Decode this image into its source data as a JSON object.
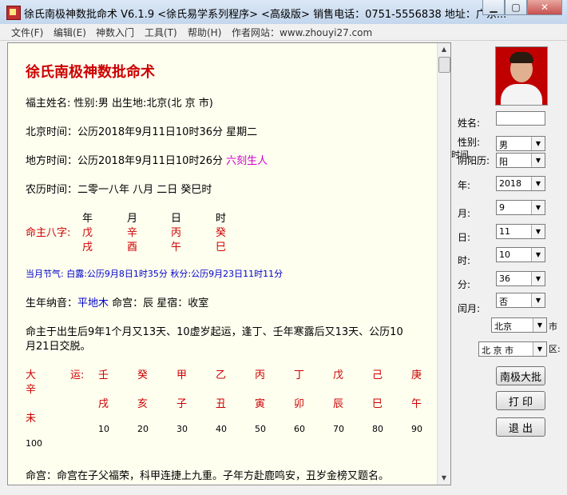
{
  "window": {
    "title": "徐氏南极神数批命术 V6.1.9 <徐氏易学系列程序> <高级版>  销售电话：0751-5556838   地址：广东...",
    "min_icon": "minimize-icon",
    "max_icon": "maximize-icon",
    "close_icon": "close-icon",
    "min_glyph": "▁",
    "max_glyph": "▢",
    "close_glyph": "✕"
  },
  "menu": [
    "文件(F)",
    "编辑(E)",
    "神数入门",
    "工具(T)",
    "帮助(H)",
    "作者网站：www.zhouyi27.com"
  ],
  "report": {
    "title": "徐氏南极神数批命术",
    "name_line": "福主姓名:   性别:男   出生地:北京(北 京 市)",
    "beijing_time": "北京时间：公历2018年9月11日10时36分  星期二",
    "local_time_prefix": "地方时间：公历2018年9月11日10时26分",
    "local_time_suffix": "六刻生人",
    "lunar": "农历时间：二零一八年  八月  二日  癸巳时",
    "bazi": {
      "label": "命主八字:",
      "headers": [
        "年",
        "月",
        "日",
        "时"
      ],
      "stems": [
        "戊",
        "辛",
        "丙",
        "癸"
      ],
      "branches": [
        "戌",
        "酉",
        "午",
        "巳"
      ]
    },
    "solar_term": "当月节气:   白露:公历9月8日1时35分  秋分:公历9月23日11时11分",
    "nayin_prefix": "生年纳音：",
    "nayin_value": "平地木",
    "nayin_suffix": "   命宫：辰   星宿：收室",
    "luck_start_1": "命主于出生后9年1个月又13天、10虚岁起运，逢丁、壬年寒露后又13天、公历10",
    "luck_start_2": "月21日交脱。",
    "dayun": {
      "label_1": "大",
      "label_2": "运:",
      "label_3": "辛",
      "label_4": "未",
      "stems": [
        "壬",
        "癸",
        "甲",
        "乙",
        "丙",
        "丁",
        "戊",
        "己",
        "庚"
      ],
      "branches": [
        "戌",
        "亥",
        "子",
        "丑",
        "寅",
        "卯",
        "辰",
        "巳",
        "午"
      ],
      "ages": [
        "10",
        "20",
        "30",
        "40",
        "50",
        "60",
        "70",
        "80",
        "90"
      ],
      "age_last": "100"
    },
    "palace": "命宫：命宫在子父福荣，科甲连捷上九重。子年方赴鹿鸣安，丑岁金榜又题名。"
  },
  "form": {
    "name_label": "姓名:",
    "gender_label": "性别:",
    "gender_value": "男",
    "calendar_label": "时间",
    "calendar_label2": "阴阳历:",
    "calendar_value": "阳",
    "year_label": "年:",
    "year_value": "2018",
    "month_label": "月:",
    "month_value": "9",
    "day_label": "日:",
    "day_value": "11",
    "hour_label": "时:",
    "hour_value": "10",
    "minute_label": "分:",
    "minute_value": "36",
    "leap_label": "闰月:",
    "leap_value": "否",
    "province_value": "北京",
    "province_suffix": "市",
    "city_value": "北 京 市",
    "city_suffix": "区:",
    "btn_calc": "南极大批",
    "btn_print": "打  印",
    "btn_exit": "退  出"
  }
}
